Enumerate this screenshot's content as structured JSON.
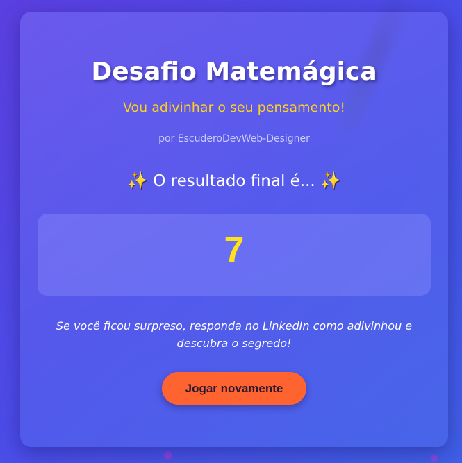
{
  "title": "Desafio Matemágica",
  "subtitle": "Vou adivinhar o seu pensamento!",
  "author": "por EscuderoDevWeb-Designer",
  "result_label": "O resultado final é...",
  "sparkle_glyph": "✨",
  "result_value": "7",
  "message": "Se você ficou surpreso, responda no LinkedIn como adivinhou e descubra o segredo!",
  "play_again_label": "Jogar novamente",
  "colors": {
    "background": "#4a4de8",
    "subtitle": "#ffd21a",
    "result_value": "#ffe21a",
    "button": "#ff6330"
  },
  "icons": [
    "sparkles-icon"
  ]
}
